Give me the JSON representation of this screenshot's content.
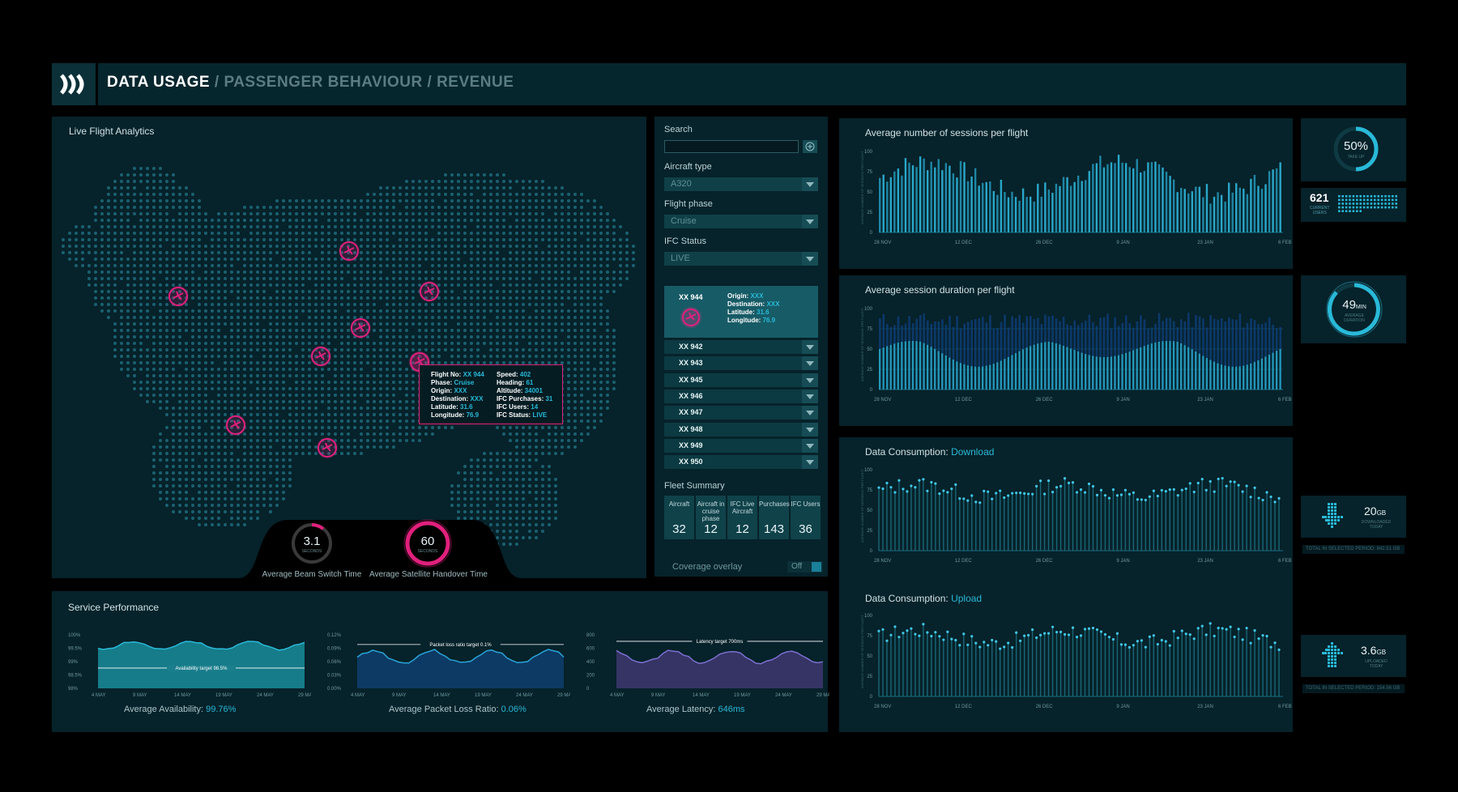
{
  "header": {
    "active": "DATA USAGE",
    "sep1": "/",
    "crumb2": "PASSENGER BEHAVIOUR",
    "sep2": "/",
    "crumb3": "REVENUE"
  },
  "map": {
    "title": "Live Flight Analytics",
    "gauge1": {
      "value": "3.1",
      "unit": "SECONDS",
      "label": "Average Beam Switch Time"
    },
    "gauge2": {
      "value": "60",
      "unit": "SECONDS",
      "label": "Average Satellite Handover Time"
    },
    "tooltip": {
      "flight_no_k": "Flight No:",
      "flight_no_v": "XX 944",
      "phase_k": "Phase:",
      "phase_v": "Cruise",
      "origin_k": "Origin:",
      "origin_v": "XXX",
      "dest_k": "Destination:",
      "dest_v": "XXX",
      "lat_k": "Latitude:",
      "lat_v": "31.6",
      "lon_k": "Longitude:",
      "lon_v": "76.9",
      "speed_k": "Speed:",
      "speed_v": "402",
      "heading_k": "Heading:",
      "heading_v": "61",
      "alt_k": "Altitude:",
      "alt_v": "34001",
      "purch_k": "IFC Purchases:",
      "purch_v": "31",
      "users_k": "IFC Users:",
      "users_v": "14",
      "status_k": "IFC Status:",
      "status_v": "LIVE"
    }
  },
  "filters": {
    "search_label": "Search",
    "search_value": "",
    "aircraft_label": "Aircraft type",
    "aircraft_value": "A320",
    "phase_label": "Flight phase",
    "phase_value": "Cruise",
    "ifc_label": "IFC Status",
    "ifc_value": "LIVE",
    "selected": {
      "flight": "XX 944",
      "origin_k": "Origin:",
      "origin_v": "XXX",
      "dest_k": "Destination:",
      "dest_v": "XXX",
      "lat_k": "Latitude:",
      "lat_v": "31.6",
      "lon_k": "Longitude:",
      "lon_v": "76.9"
    },
    "flights": [
      "XX 942",
      "XX 943",
      "XX 945",
      "XX 946",
      "XX 947",
      "XX 948",
      "XX 949",
      "XX 950"
    ],
    "fleet_label": "Fleet Summary",
    "fleet": [
      {
        "h": "Aircraft",
        "v": "32"
      },
      {
        "h": "Aircraft in cruise phase",
        "v": "12"
      },
      {
        "h": "IFC Live Aircraft",
        "v": "12"
      },
      {
        "h": "Purchases",
        "v": "143"
      },
      {
        "h": "IFC Users",
        "v": "36"
      }
    ],
    "coverage_label": "Coverage overlay",
    "coverage_value": "Off"
  },
  "service": {
    "title": "Service Performance",
    "c1": {
      "yticks": [
        "100%",
        "99.5%",
        "99%",
        "98.5%",
        "98%"
      ],
      "target": "Availability target 98.5%",
      "stat_k": "Average Availability:",
      "stat_v": "99.76%"
    },
    "c2": {
      "yticks": [
        "0.12%",
        "0.09%",
        "0.06%",
        "0.03%",
        "0.00%"
      ],
      "target": "Packet loss ratio target 0.1%",
      "stat_k": "Average Packet Loss Ratio:",
      "stat_v": "0.06%"
    },
    "c3": {
      "yticks": [
        "800",
        "600",
        "400",
        "200",
        "0"
      ],
      "target": "Latency target 700ms",
      "stat_k": "Average Latency:",
      "stat_v": "646ms"
    },
    "xticks": [
      "4 MAY",
      "9 MAY",
      "14 MAY",
      "19 MAY",
      "24 MAY",
      "29 MAY"
    ]
  },
  "charts": {
    "sessions_title": "Average number of sessions per flight",
    "duration_title": "Average session duration per flight",
    "download_title_k": "Data Consumption:",
    "download_title_v": "Download",
    "upload_title_k": "Data Consumption:",
    "upload_title_v": "Upload",
    "ylabel": "AVERAGE NUMBER OF SESSIONS PER FLIGHT",
    "xticks": [
      "28 NOV",
      "12 DEC",
      "26 DEC",
      "9 JAN",
      "23 JAN",
      "6 FEB"
    ],
    "yticks": [
      "100",
      "75",
      "50",
      "25",
      "0"
    ]
  },
  "side": {
    "take_pct": "50%",
    "take_label": "TAKE UP",
    "users_value": "621",
    "users_label1": "CURRENT",
    "users_label2": "USERS",
    "duration_value": "49",
    "duration_unit": "MIN",
    "duration_l1": "AVERAGE",
    "duration_l2": "DURATION",
    "dl_value": "20",
    "dl_unit": "GB",
    "dl_l1": "DOWNLOADED",
    "dl_l2": "TODAY",
    "dl_total": "TOTAL IN SELECTED PERIOD: 842.51 GB",
    "ul_value": "3.6",
    "ul_unit": "GB",
    "ul_l1": "UPLOADED",
    "ul_l2": "TODAY",
    "ul_total": "TOTAL IN SELECTED PERIOD: 154.56 GB"
  },
  "colors": {
    "accent": "#29b9d8",
    "magenta": "#e0207c",
    "panel": "#06222a"
  }
}
